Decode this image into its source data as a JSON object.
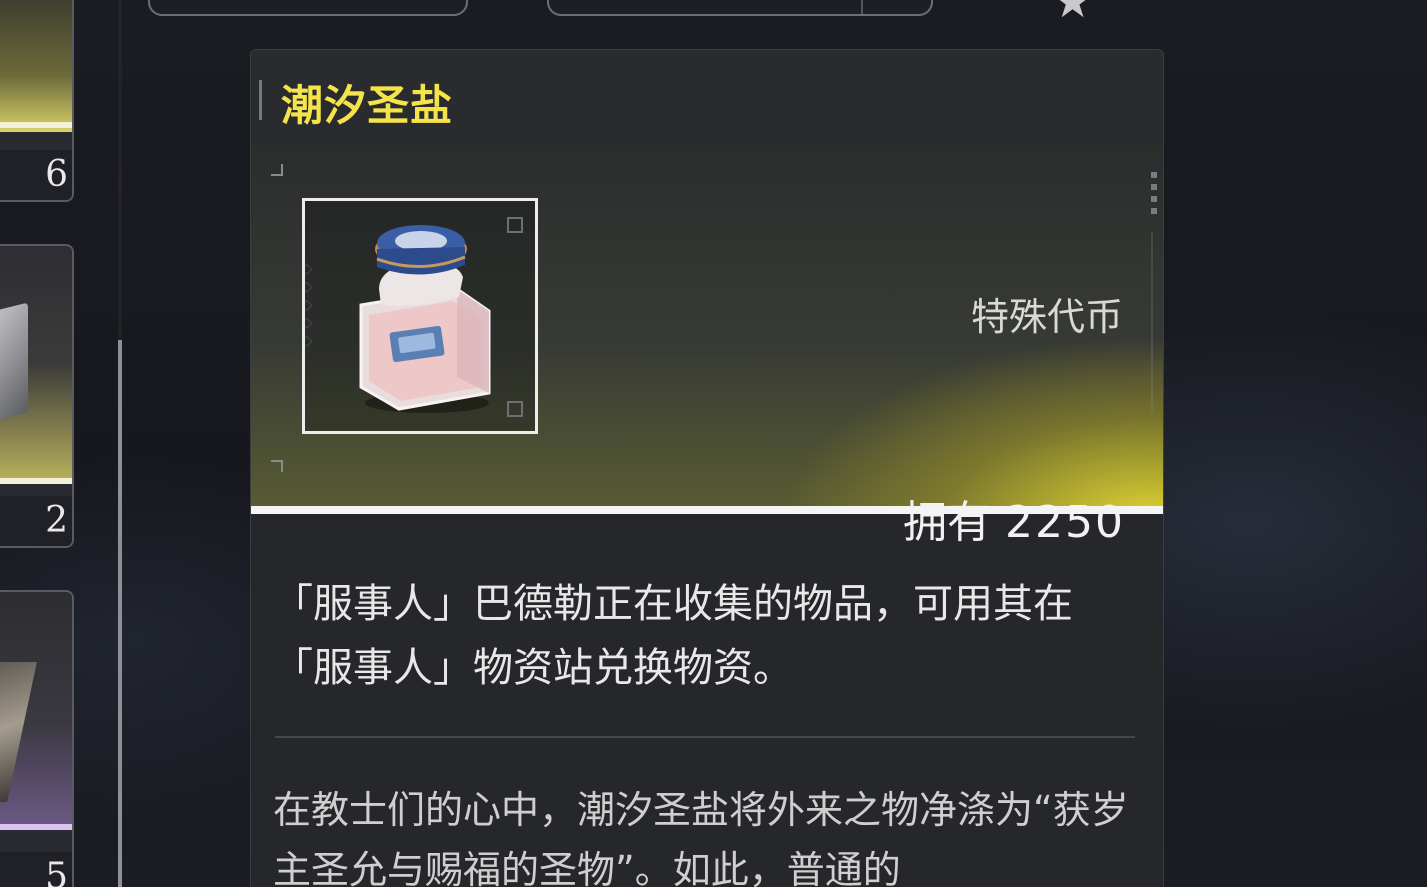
{
  "item": {
    "name": "潮汐圣盐",
    "type": "特殊代币",
    "owned_label": "拥有",
    "owned_value": "2250",
    "icon": "salt-jar-icon",
    "description": "「服事人」巴德勒正在收集的物品，可用其在「服事人」物资站兑换物资。",
    "lore": "在教士们的心中，潮汐圣盐将外来之物净涤为“获岁主圣允与赐福的圣物”。如此，普通的"
  },
  "inventory": {
    "counts": [
      "6",
      "2",
      "5"
    ]
  },
  "colors": {
    "title": "#f5e34a",
    "banner_glow": "#e8db32",
    "panel_bg": "#26272b"
  }
}
